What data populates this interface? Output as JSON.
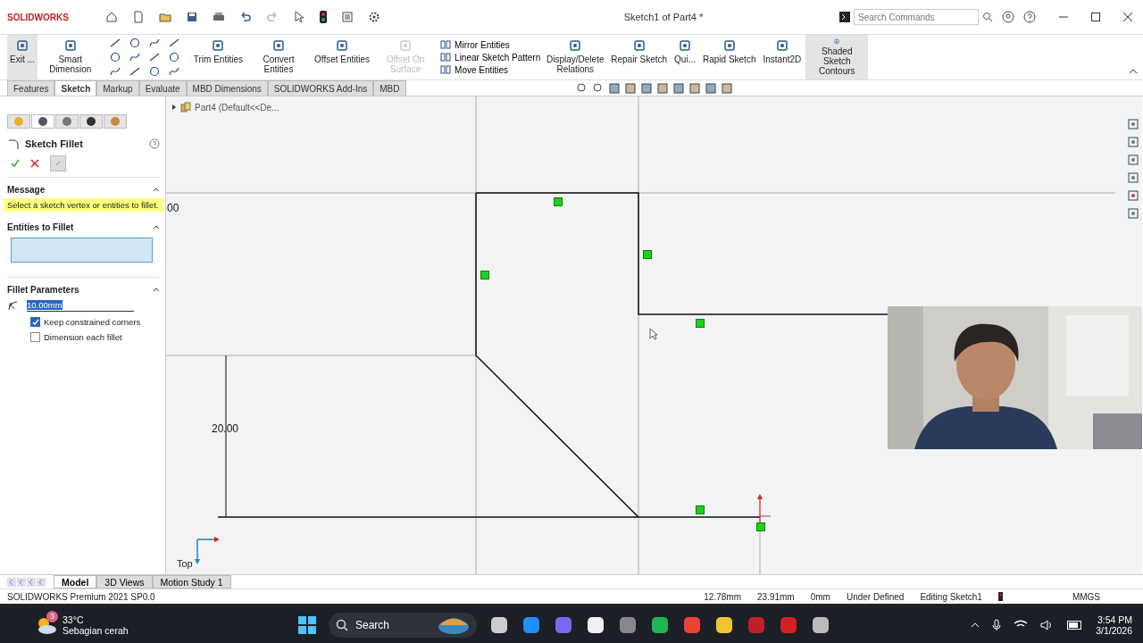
{
  "app": {
    "logo": "SOLIDWORKS",
    "title": "Sketch1 of Part4 *",
    "search": {
      "placeholder": "Search Commands"
    }
  },
  "ribbon": [
    {
      "kind": "large",
      "label": "Exit ...",
      "selected": true,
      "disabled": false
    },
    {
      "kind": "large",
      "label": "Smart Dimension",
      "selected": false,
      "disabled": false
    },
    {
      "kind": "tools"
    },
    {
      "kind": "large",
      "label": "Trim Entities",
      "selected": false,
      "disabled": false
    },
    {
      "kind": "large",
      "label": "Convert Entities",
      "selected": false,
      "disabled": false
    },
    {
      "kind": "large",
      "label": "Offset Entities",
      "selected": false,
      "disabled": false
    },
    {
      "kind": "large",
      "label": "Offset On Surface",
      "selected": false,
      "disabled": true
    },
    {
      "kind": "stack",
      "items": [
        "Mirror Entities",
        "Linear Sketch Pattern",
        "Move Entities"
      ]
    },
    {
      "kind": "large",
      "label": "Display/Delete Relations",
      "selected": false,
      "disabled": false
    },
    {
      "kind": "large",
      "label": "Repair Sketch",
      "selected": false,
      "disabled": false
    },
    {
      "kind": "large",
      "label": "Qui...",
      "selected": false,
      "disabled": false
    },
    {
      "kind": "large",
      "label": "Rapid Sketch",
      "selected": false,
      "disabled": false
    },
    {
      "kind": "large",
      "label": "Instant2D",
      "selected": false,
      "disabled": false
    },
    {
      "kind": "large",
      "label": "Shaded Sketch Contours",
      "selected": true,
      "disabled": false
    }
  ],
  "command_tabs": [
    {
      "label": "Features",
      "selected": false
    },
    {
      "label": "Sketch",
      "selected": true
    },
    {
      "label": "Markup",
      "selected": false
    },
    {
      "label": "Evaluate",
      "selected": false
    },
    {
      "label": "MBD Dimensions",
      "selected": false
    },
    {
      "label": "SOLIDWORKS Add-Ins",
      "selected": false
    },
    {
      "label": "MBD",
      "selected": false
    }
  ],
  "property_manager": {
    "title": "Sketch Fillet",
    "message_heading": "Message",
    "message": "Select a sketch vertex or entities to fillet.",
    "entities_heading": "Entities to Fillet",
    "parameters_heading": "Fillet Parameters",
    "radius": "10.00mm",
    "options": [
      {
        "label": "Keep constrained corners",
        "checked": true
      },
      {
        "label": "Dimension each fillet",
        "checked": false
      }
    ]
  },
  "feature_tree": {
    "item": "Part4  (Default<<De..."
  },
  "canvas": {
    "dimension": "20.00",
    "partial_dimension": "00",
    "view": "Top"
  },
  "bottom_tabs": [
    {
      "label": "Model",
      "selected": true
    },
    {
      "label": "3D Views",
      "selected": false
    },
    {
      "label": "Motion Study 1",
      "selected": false
    }
  ],
  "status_bar": {
    "product": "SOLIDWORKS Premium 2021 SP0.0",
    "x": "12.78mm",
    "y": "23.91mm",
    "z": "0mm",
    "state": "Under Defined",
    "editing": "Editing Sketch1",
    "units": "MMGS"
  },
  "taskbar": {
    "badge": "3",
    "temperature": "33°C",
    "weather": "Sebagian cerah",
    "search": "Search",
    "time": "3:54 PM",
    "date": "3/1/2026"
  }
}
